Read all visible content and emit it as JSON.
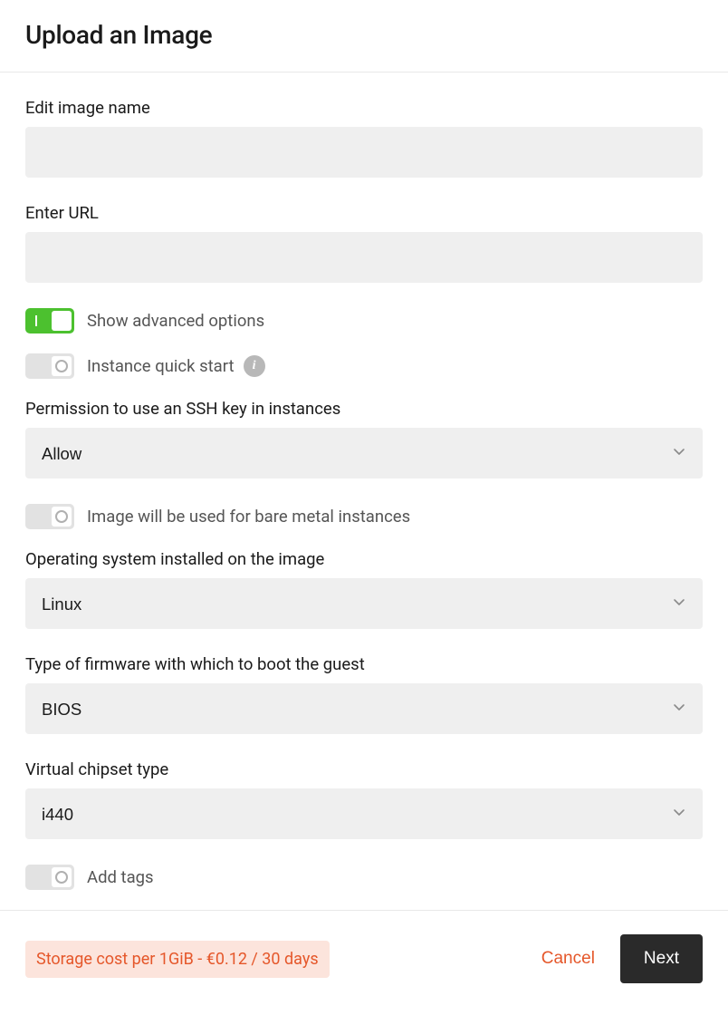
{
  "header": {
    "title": "Upload an Image"
  },
  "form": {
    "image_name": {
      "label": "Edit image name",
      "value": ""
    },
    "url": {
      "label": "Enter URL",
      "value": ""
    },
    "advanced": {
      "label": "Show advanced options",
      "on": true
    },
    "quick_start": {
      "label": "Instance quick start",
      "on": false
    },
    "ssh_permission": {
      "label": "Permission to use an SSH key in instances",
      "value": "Allow"
    },
    "bare_metal": {
      "label": "Image will be used for bare metal instances",
      "on": false
    },
    "os": {
      "label": "Operating system installed on the image",
      "value": "Linux"
    },
    "firmware": {
      "label": "Type of firmware with which to boot the guest",
      "value": "BIOS"
    },
    "chipset": {
      "label": "Virtual chipset type",
      "value": "i440"
    },
    "add_tags": {
      "label": "Add tags",
      "on": false
    }
  },
  "footer": {
    "storage_cost": "Storage cost per 1GiB - €0.12 / 30 days",
    "cancel": "Cancel",
    "next": "Next"
  }
}
